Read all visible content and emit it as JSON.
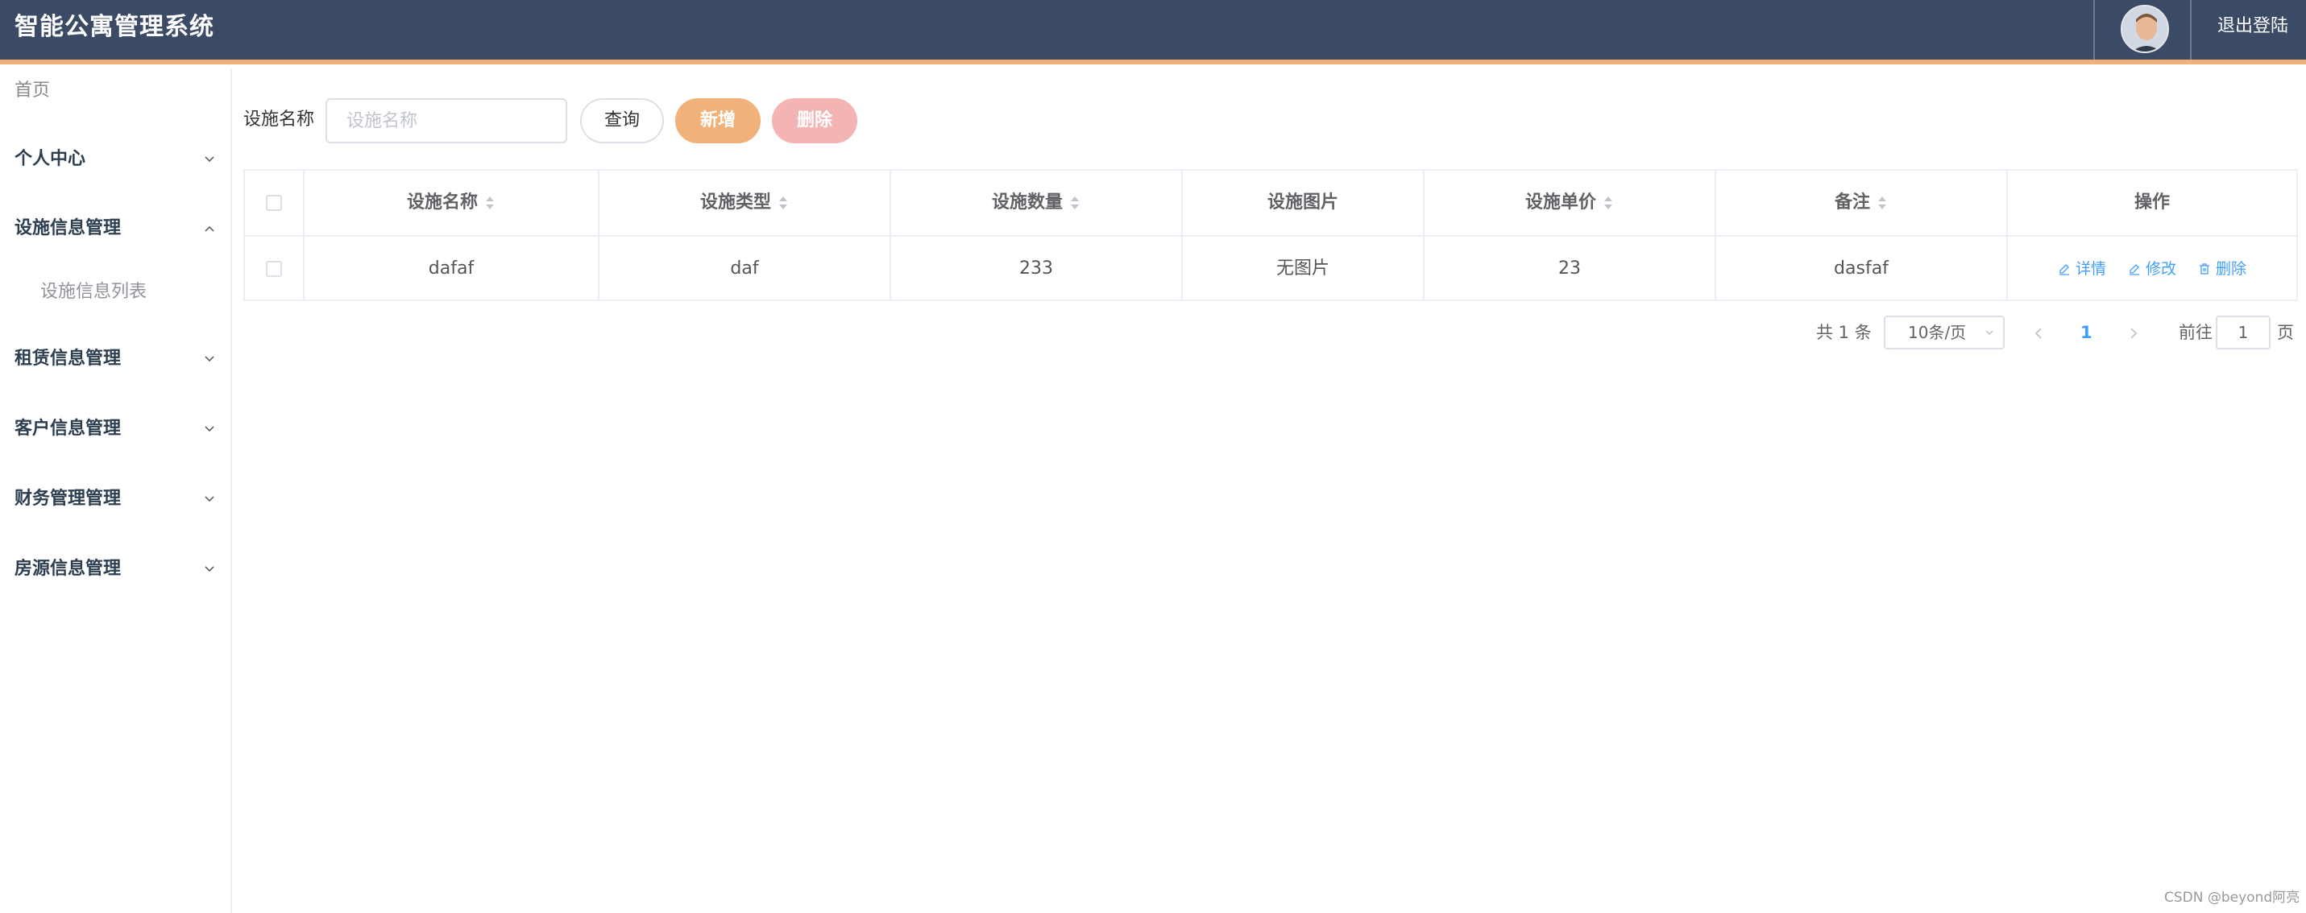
{
  "app": {
    "title": "智能公寓管理系统",
    "logout": "退出登陆"
  },
  "sidebar": {
    "home": "首页",
    "groups": [
      {
        "label": "个人中心",
        "expanded": false
      },
      {
        "label": "设施信息管理",
        "expanded": true,
        "children": [
          "设施信息列表"
        ]
      },
      {
        "label": "租赁信息管理",
        "expanded": false
      },
      {
        "label": "客户信息管理",
        "expanded": false
      },
      {
        "label": "财务管理管理",
        "expanded": false
      },
      {
        "label": "房源信息管理",
        "expanded": false
      }
    ]
  },
  "search": {
    "label": "设施名称",
    "placeholder": "设施名称",
    "value": "",
    "query_btn": "查询",
    "add_btn": "新增",
    "delete_btn": "删除"
  },
  "table": {
    "columns": [
      "设施名称",
      "设施类型",
      "设施数量",
      "设施图片",
      "设施单价",
      "备注",
      "操作"
    ],
    "rows": [
      {
        "name": "dafaf",
        "type": "daf",
        "quantity": "233",
        "image": "无图片",
        "price": "23",
        "remark": "dasfaf"
      }
    ],
    "actions": {
      "detail": "详情",
      "edit": "修改",
      "delete": "删除"
    }
  },
  "pagination": {
    "total": "共 1 条",
    "page_size": "10条/页",
    "current": "1",
    "goto_label": "前往",
    "goto_value": "1",
    "page_suffix": "页"
  },
  "watermark": "CSDN @beyond阿亮",
  "colors": {
    "header": "#3b4b66",
    "accent": "#f0b27a",
    "danger_light": "#f4b4b4",
    "link": "#409eff"
  }
}
